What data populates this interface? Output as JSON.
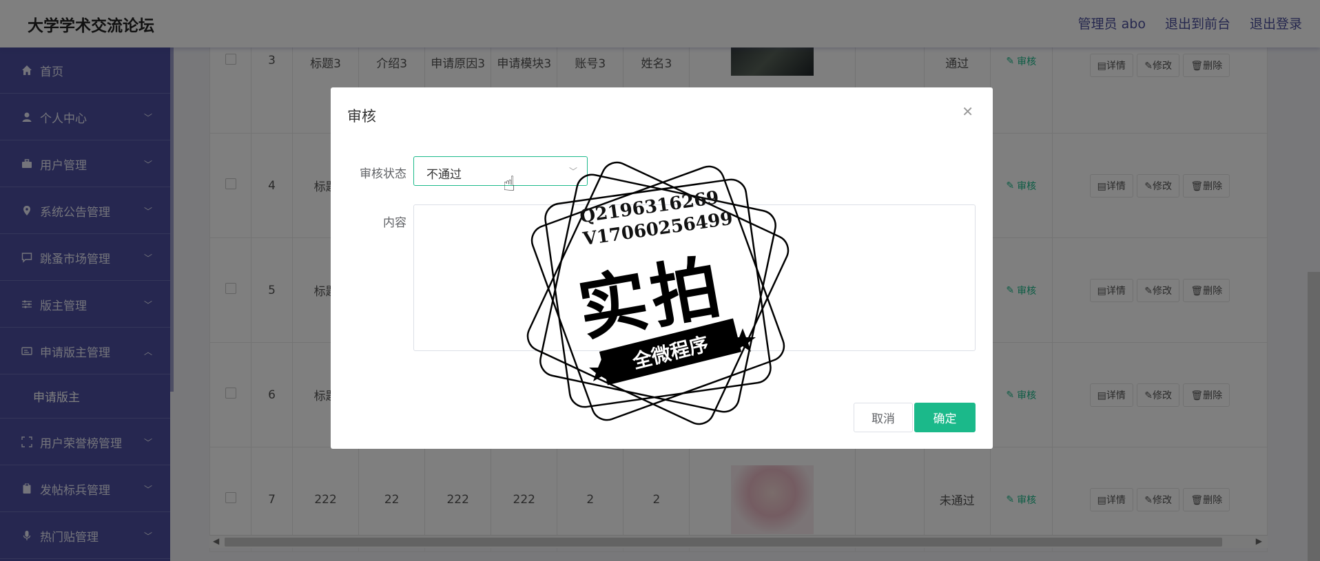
{
  "header": {
    "site_title": "大学学术交流论坛",
    "links": [
      "管理员 abo",
      "退出到前台",
      "退出登录"
    ]
  },
  "sidebar": {
    "items": [
      {
        "label": "首页",
        "icon": "home-icon",
        "chevron": ""
      },
      {
        "label": "个人中心",
        "icon": "user-icon",
        "chevron": "﹀"
      },
      {
        "label": "用户管理",
        "icon": "briefcase-icon",
        "chevron": "﹀"
      },
      {
        "label": "系统公告管理",
        "icon": "location-icon",
        "chevron": "﹀"
      },
      {
        "label": "跳蚤市场管理",
        "icon": "chat-icon",
        "chevron": "﹀"
      },
      {
        "label": "版主管理",
        "icon": "sliders-icon",
        "chevron": "﹀"
      },
      {
        "label": "申请版主管理",
        "icon": "id-card-icon",
        "chevron": "︿"
      },
      {
        "label": "用户荣誉榜管理",
        "icon": "frame-icon",
        "chevron": "﹀"
      },
      {
        "label": "发帖标兵管理",
        "icon": "clipboard-icon",
        "chevron": "﹀"
      },
      {
        "label": "热门贴管理",
        "icon": "mic-icon",
        "chevron": "﹀"
      }
    ],
    "sub_item": "申请版主"
  },
  "table": {
    "rows": [
      {
        "id": "3",
        "title": "标题3",
        "intro": "介绍3",
        "reason": "申请原因3",
        "module": "申请模块3",
        "account": "账号3",
        "name": "姓名3",
        "status": "通过",
        "image": "dark"
      },
      {
        "id": "4",
        "title": "标题",
        "intro": "",
        "reason": "",
        "module": "",
        "account": "",
        "name": "",
        "status": "",
        "image": ""
      },
      {
        "id": "5",
        "title": "标题",
        "intro": "",
        "reason": "",
        "module": "",
        "account": "",
        "name": "",
        "status": "",
        "image": ""
      },
      {
        "id": "6",
        "title": "标题",
        "intro": "",
        "reason": "",
        "module": "",
        "account": "",
        "name": "",
        "status": "",
        "image": ""
      },
      {
        "id": "7",
        "title": "222",
        "intro": "22",
        "reason": "222",
        "module": "222",
        "account": "2",
        "name": "2",
        "status": "未通过",
        "image": "girl"
      }
    ],
    "actions": {
      "review": "审核",
      "detail": "详情",
      "edit": "修改",
      "delete": "删除"
    }
  },
  "dialog": {
    "title": "审核",
    "status_label": "审核状态",
    "status_value": "不通过",
    "content_label": "内容",
    "content_value": "",
    "cancel_label": "取消",
    "ok_label": "确定"
  },
  "watermark": {
    "line1": "Q2196316269",
    "line2": "V17060256499",
    "big": "实拍",
    "ribbon": "全微程序"
  },
  "colors": {
    "accent": "#1bb98a",
    "sidebar": "#4c4fa0",
    "header_link": "#4a4e9c"
  }
}
